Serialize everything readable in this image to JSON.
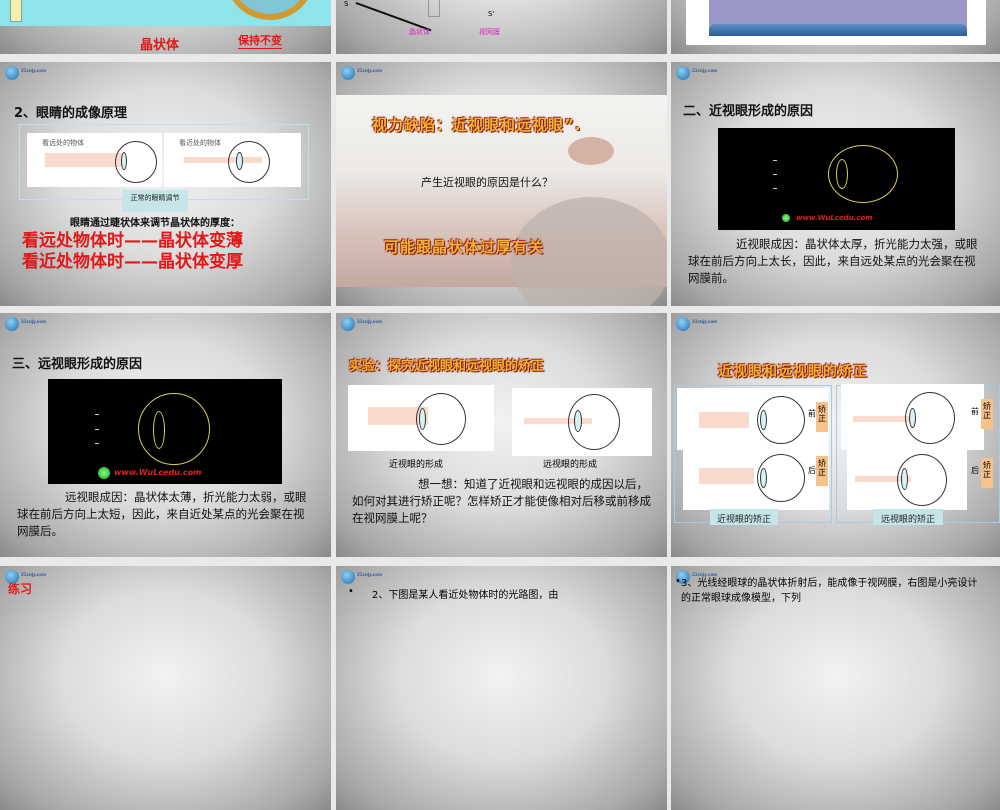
{
  "logo_text": "21cnjy.com",
  "slides": [
    {
      "labels": {
        "lens": "晶状体",
        "keep": "保持不变"
      }
    },
    {
      "labels": {
        "s": "S",
        "s_prime": "S'",
        "lens": "晶状体",
        "retina": "视网膜"
      }
    },
    {},
    {
      "title": "2、眼睛的成像原理",
      "panel_far": "看远处的物体",
      "panel_near": "看近处的物体",
      "caption": "正常的眼睛调节",
      "body": "眼睛通过睫状体来调节晶状体的厚度：",
      "red_lines": [
        "看远处物体时——晶状体变薄",
        "看近处物体时——晶状体变厚"
      ]
    },
    {
      "wordart_top": "视力缺陷：近视眼和远视眼”.",
      "question": "产生近视眼的原因是什么？",
      "wordart_bottom": "可能跟晶状体过厚有关"
    },
    {
      "title": "二、近视眼形成的原因",
      "site": "www.WuLcedu.com",
      "body": "近视眼成因：晶状体太厚，折光能力太强，或眼球在前后方向上太长，因此，来自远处某点的光会聚在视网膜前。"
    },
    {
      "title": "三、远视眼形成的原因",
      "site": "www.WuLcedu.com",
      "body": "远视眼成因：晶状体太薄，折光能力太弱，或眼球在前后方向上太短，因此，来自近处某点的光会聚在视网膜后。"
    },
    {
      "wordart": "实验：探究近视眼和远视眼的矫正",
      "cap_left": "近视眼的形成",
      "cap_right": "远视眼的形成",
      "body": "想一想：知道了近视眼和远视眼的成因以后，如何对其进行矫正呢？怎样矫正才能使像相对后移或前移成在视网膜上呢？"
    },
    {
      "wordart": "近视眼和远视眼的矫正",
      "before": "前",
      "after": "后",
      "tag": "矫正",
      "cap_left": "近视眼的矫正",
      "cap_right": "远视眼的矫正"
    },
    {
      "title": "练习"
    },
    {
      "bullet": "•",
      "body": "2、下图是某人看近处物体时的光路图，由"
    },
    {
      "bullet": "•",
      "body": "3、光线经眼球的晶状体折射后，能成像于视网膜，右图是小亮设计的正常眼球成像模型，下列"
    }
  ]
}
